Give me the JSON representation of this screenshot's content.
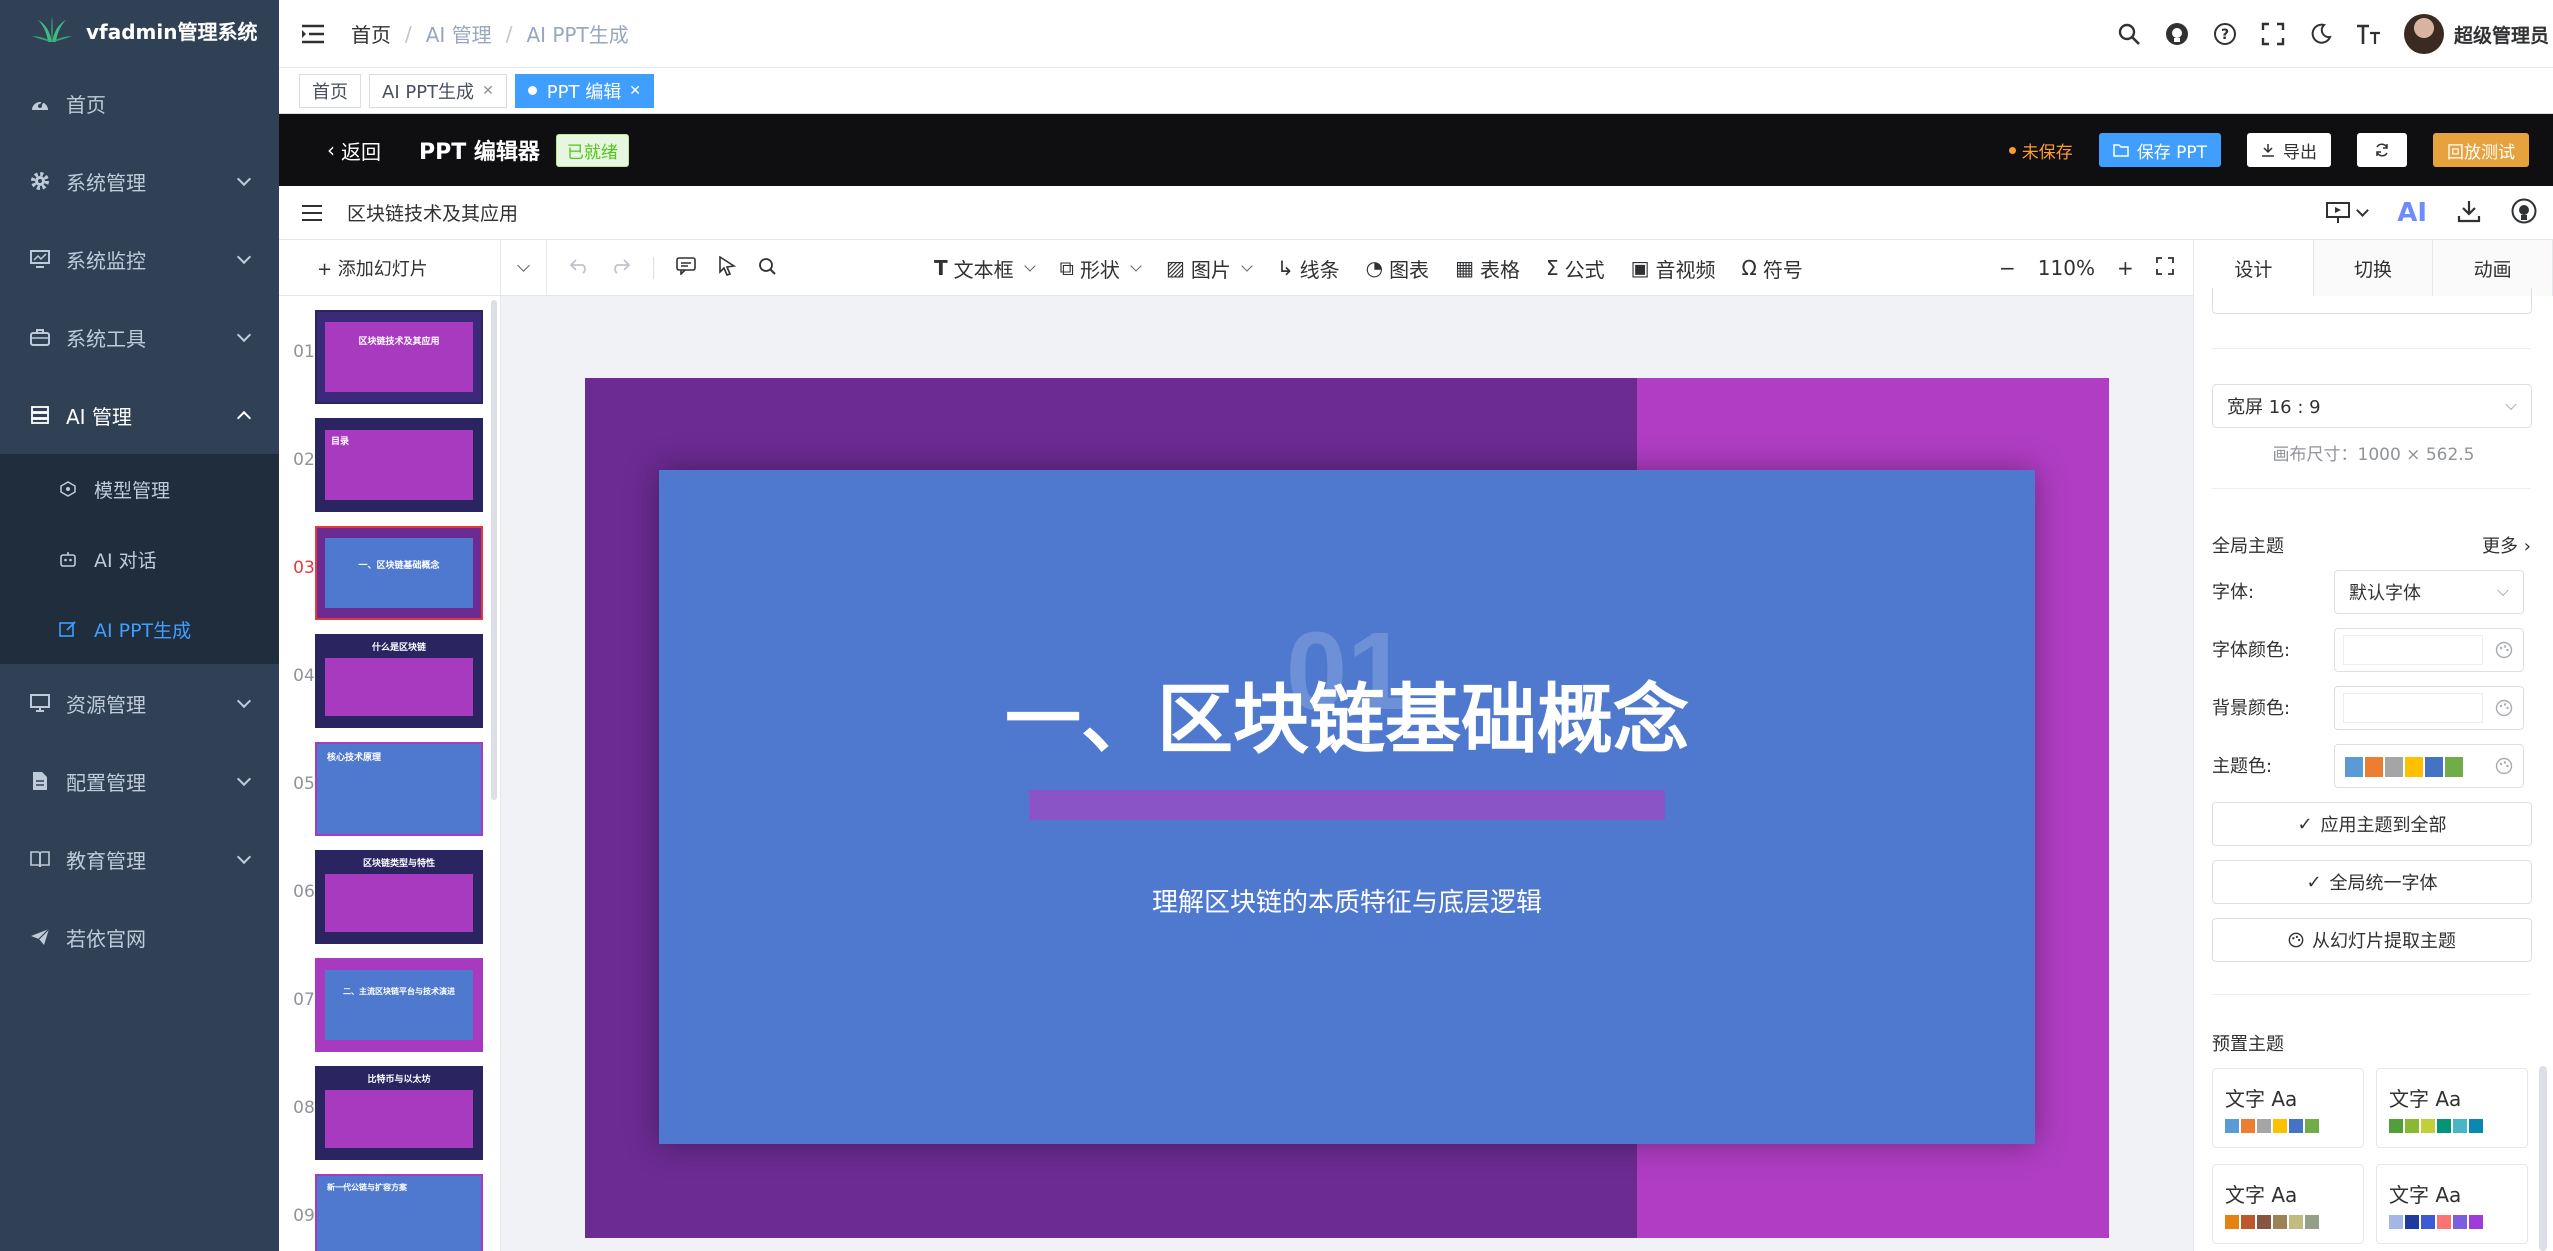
{
  "sidebar": {
    "brand": "vfadmin管理系统",
    "items": [
      {
        "label": "首页"
      },
      {
        "label": "系统管理"
      },
      {
        "label": "系统监控"
      },
      {
        "label": "系统工具"
      },
      {
        "label": "AI 管理"
      },
      {
        "label": "资源管理"
      },
      {
        "label": "配置管理"
      },
      {
        "label": "教育管理"
      },
      {
        "label": "若依官网"
      }
    ],
    "ai_sub": [
      {
        "label": "模型管理"
      },
      {
        "label": "AI 对话"
      },
      {
        "label": "AI PPT生成"
      }
    ]
  },
  "navbar": {
    "breadcrumb": [
      "首页",
      "AI 管理",
      "AI PPT生成"
    ],
    "user_name": "超级管理员"
  },
  "tags": [
    {
      "label": "首页"
    },
    {
      "label": "AI PPT生成"
    },
    {
      "label": "PPT 编辑"
    }
  ],
  "editor": {
    "back_label": "返回",
    "title": "PPT 编辑器",
    "status_badge": "已就绪",
    "unsaved": "未保存",
    "save_label": "保存 PPT",
    "export_label": "导出",
    "playback_label": "回放测试",
    "doc_name": "区块链技术及其应用",
    "ai_label": "AI"
  },
  "toolbar": {
    "add_slide": "+ 添加幻灯片",
    "tools": [
      "文本框",
      "形状",
      "图片",
      "线条",
      "图表",
      "表格",
      "公式",
      "音视频",
      "符号"
    ],
    "zoom": "110%",
    "right_tabs": [
      "设计",
      "切换",
      "动画"
    ]
  },
  "thumbnails": [
    {
      "num": "01",
      "text": "区块链技术及其应用"
    },
    {
      "num": "02",
      "text": "目录"
    },
    {
      "num": "03",
      "text": "一、区块链基础概念"
    },
    {
      "num": "04",
      "text": "什么是区块链"
    },
    {
      "num": "05",
      "text": "核心技术原理"
    },
    {
      "num": "06",
      "text": "区块链类型与特性"
    },
    {
      "num": "07",
      "text": "二、主流区块链平台与技术演进"
    },
    {
      "num": "08",
      "text": "比特币与以太坊"
    },
    {
      "num": "09",
      "text": "新一代公链与扩容方案"
    }
  ],
  "slide": {
    "number": "01",
    "title": "一、区块链基础概念",
    "subtitle": "理解区块链的本质特征与底层逻辑",
    "colors": {
      "bg": "#6b2b92",
      "band": "#b03dc4",
      "panel": "#4f78cf",
      "bar": "#8a54c6"
    }
  },
  "design_panel": {
    "ratio": "宽屏 16 : 9",
    "canvas_size": "画布尺寸：1000 × 562.5",
    "global_theme": "全局主题",
    "more": "更多",
    "font_label": "字体:",
    "font_value": "默认字体",
    "font_color_label": "字体颜色:",
    "bg_color_label": "背景颜色:",
    "theme_color_label": "主题色:",
    "theme_colors": [
      "#5b9bd5",
      "#ed7d31",
      "#a5a5a5",
      "#ffc000",
      "#4472c4",
      "#70ad47"
    ],
    "apply_all": "应用主题到全部",
    "unify_font": "全局统一字体",
    "extract_theme": "从幻灯片提取主题",
    "preset_title": "预置主题",
    "presets": [
      {
        "text": "文字 Aa",
        "colors": [
          "#5b9bd5",
          "#ed7d31",
          "#a5a5a5",
          "#ffc000",
          "#4472c4",
          "#70ad47"
        ]
      },
      {
        "text": "文字 Aa",
        "colors": [
          "#549e39",
          "#8ab833",
          "#c0cf3a",
          "#029676",
          "#4ab5c4",
          "#0989b1"
        ]
      },
      {
        "text": "文字 Aa",
        "colors": [
          "#e48312",
          "#bd582c",
          "#865640",
          "#9b8357",
          "#c2bc80",
          "#94a088"
        ]
      },
      {
        "text": "文字 Aa",
        "colors": [
          "#a5b5e4",
          "#1f3ba0",
          "#3d5ad6",
          "#fd7272",
          "#7c5de0",
          "#9d3cd9"
        ]
      }
    ]
  }
}
